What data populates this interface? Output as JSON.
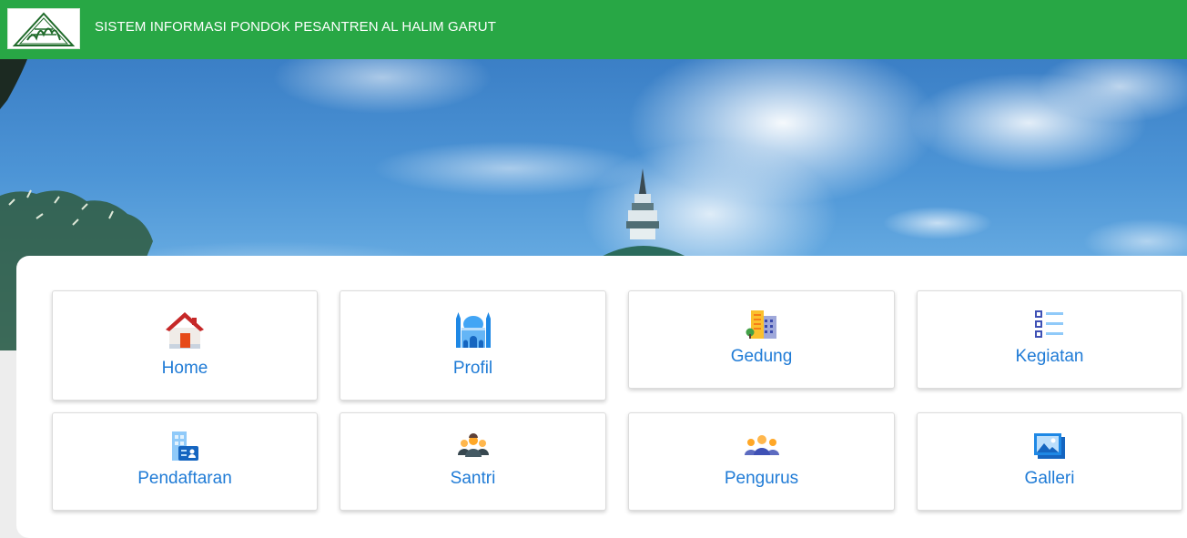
{
  "navbar": {
    "title": "SISTEM INFORMASI PONDOK PESANTREN AL HALIM GARUT",
    "bg_color": "#28a745",
    "logo_icon": "pesantren-logo-icon"
  },
  "hero": {
    "image": "mosque-dome-sky-photo"
  },
  "menu": {
    "link_color": "#1f7bd6",
    "items": [
      {
        "label": "Home",
        "icon": "house-icon"
      },
      {
        "label": "Profil",
        "icon": "mosque-icon"
      },
      {
        "label": "Gedung",
        "icon": "building-icon"
      },
      {
        "label": "Kegiatan",
        "icon": "list-icon"
      },
      {
        "label": "Pendaftaran",
        "icon": "registration-id-card-icon"
      },
      {
        "label": "Santri",
        "icon": "students-group-icon"
      },
      {
        "label": "Pengurus",
        "icon": "team-icon"
      },
      {
        "label": "Galleri",
        "icon": "gallery-image-icon"
      }
    ]
  }
}
